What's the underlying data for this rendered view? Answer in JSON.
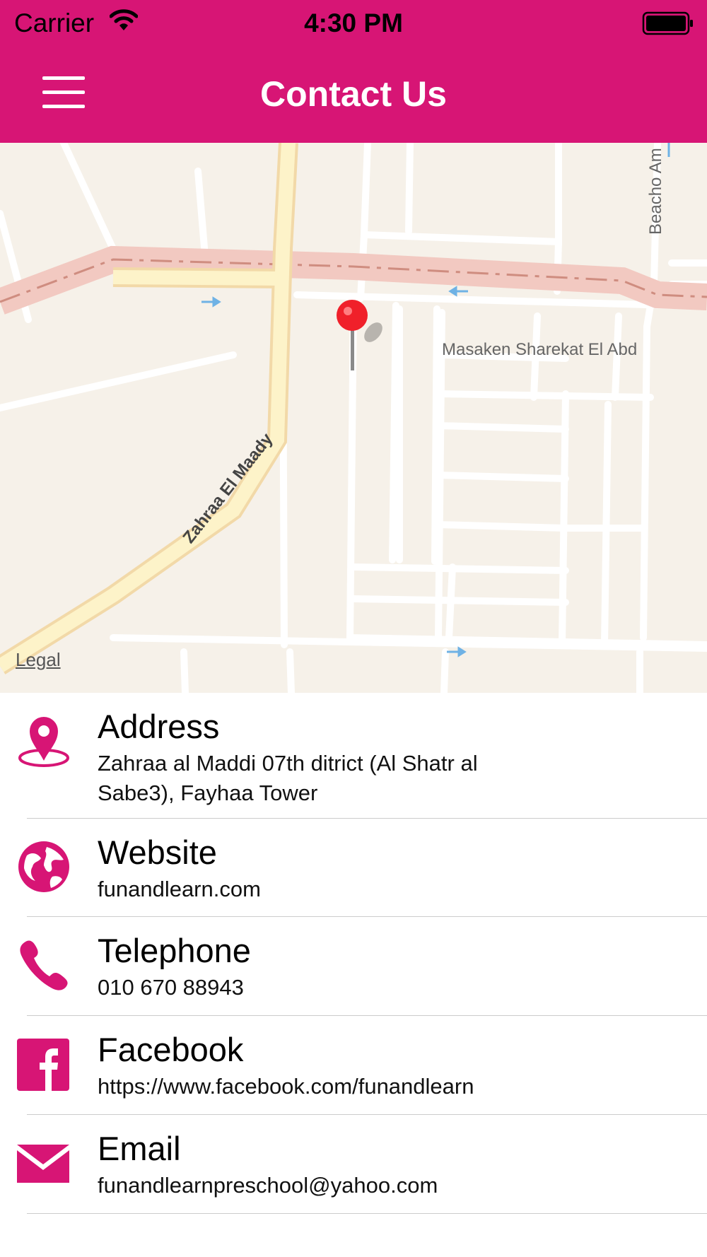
{
  "status": {
    "carrier": "Carrier",
    "time": "4:30 PM"
  },
  "nav": {
    "title": "Contact Us"
  },
  "map": {
    "legal": "Legal",
    "labels": {
      "street1": "Zahraa El Maady",
      "district": "Masaken Sharekat El Abd",
      "street2": "Beacho Am"
    }
  },
  "contacts": [
    {
      "label": "Address",
      "value": "Zahraa al Maddi 07th ditrict (Al Shatr al",
      "value2": "Sabe3), Fayhaa Tower",
      "icon": "location-pin-icon"
    },
    {
      "label": "Website",
      "value": "funandlearn.com",
      "icon": "globe-icon"
    },
    {
      "label": "Telephone",
      "value": "010 670 88943",
      "icon": "phone-icon"
    },
    {
      "label": "Facebook",
      "value": "https://www.facebook.com/funandlearn",
      "icon": "facebook-icon"
    },
    {
      "label": "Email",
      "value": "funandlearnpreschool@yahoo.com",
      "icon": "mail-icon"
    }
  ],
  "colors": {
    "accent": "#d71575",
    "map_bg": "#f6f1e9"
  }
}
